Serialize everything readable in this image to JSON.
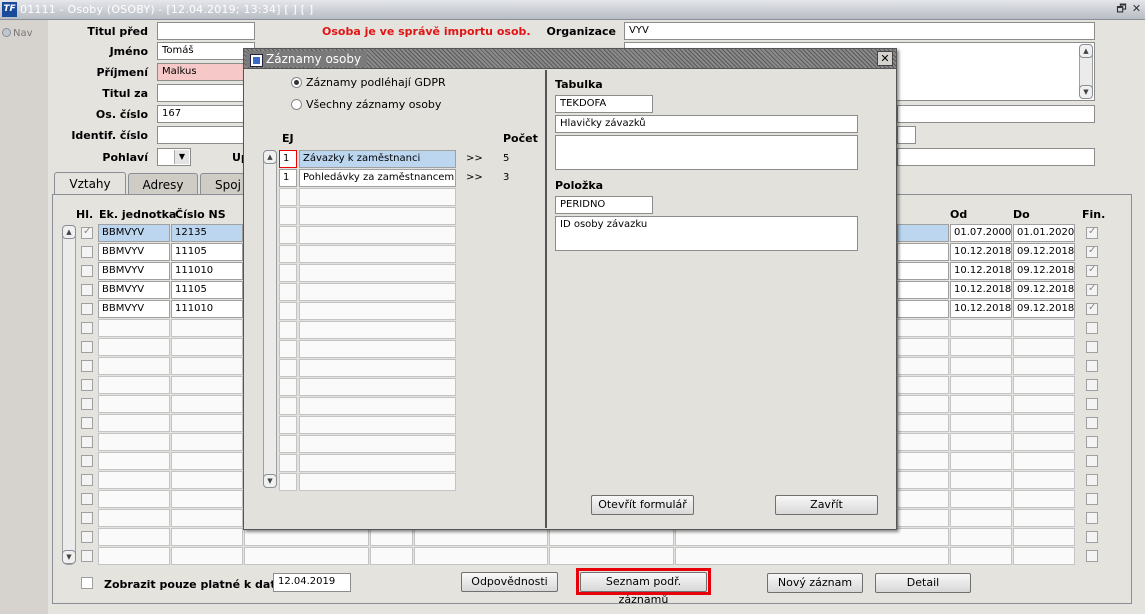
{
  "window": {
    "app_icon": "TF",
    "title": "01111 - Osoby (OSOBY) - [12.04.2019; 13:34]  [ ]  [ ]",
    "restore_glyph": "🗗",
    "close_glyph": "✕"
  },
  "nav": {
    "label": "Nav"
  },
  "form": {
    "titul_pred_label": "Titul před",
    "import_warning": "Osoba je ve správě importu osob.",
    "organizace_label": "Organizace",
    "organizace_value": "VYV",
    "jmeno_label": "Jméno",
    "jmeno_value": "Tomáš",
    "prijmeni_label": "Příjmení",
    "prijmeni_value": "Malkus",
    "titul_za_label": "Titul za",
    "os_cislo_label": "Os. číslo",
    "os_cislo_value": "167",
    "identif_label": "Identif. číslo",
    "pohlavi_label": "Pohlaví",
    "up_label": "Up"
  },
  "tabs": [
    {
      "label": "Vztahy"
    },
    {
      "label": "Adresy"
    },
    {
      "label": "Spoj"
    }
  ],
  "grid": {
    "headers": {
      "hl": "Hl.",
      "ek": "Ek. jednotka",
      "ns": "Číslo NS",
      "od": "Od",
      "do": "Do",
      "fin": "Fin."
    },
    "rows": [
      {
        "ek": "BBMVYV",
        "ns": "12135",
        "od": "01.07.2000",
        "do": "01.01.2020"
      },
      {
        "ek": "BBMVYV",
        "ns": "11105",
        "od": "10.12.2018",
        "do": "09.12.2018"
      },
      {
        "ek": "BBMVYV",
        "ns": "111010",
        "od": "10.12.2018",
        "do": "09.12.2018"
      },
      {
        "ek": "BBMVYV",
        "ns": "11105",
        "od": "10.12.2018",
        "do": "09.12.2018"
      },
      {
        "ek": "BBMVYV",
        "ns": "111010",
        "od": "10.12.2018",
        "do": "09.12.2018"
      }
    ]
  },
  "bottom": {
    "only_valid_label": "Zobrazit pouze platné k datu :",
    "date_value": "12.04.2019",
    "odpovednosti": "Odpovědnosti",
    "seznam": "Seznam podř. záznamů",
    "novy": "Nový záznam",
    "detail": "Detail"
  },
  "dialog": {
    "title": "Záznamy osoby",
    "radio_gdpr": "Záznamy podléhají GDPR",
    "radio_all": "Všechny záznamy osoby",
    "col_ej": "EJ",
    "col_pocet": "Počet",
    "records": [
      {
        "ej": "1",
        "name": "Závazky k zaměstnanci",
        "arrow": ">>",
        "count": "5"
      },
      {
        "ej": "1",
        "name": "Pohledávky za zaměstnancem",
        "arrow": ">>",
        "count": "3"
      }
    ],
    "tabulka_label": "Tabulka",
    "tabulka_code": "TEKDOFA",
    "tabulka_desc": "Hlavičky závazků",
    "polozka_label": "Položka",
    "polozka_code": "PERIDNO",
    "polozka_desc": "ID osoby závazku",
    "btn_open": "Otevřít formulář",
    "btn_close": "Zavřít"
  }
}
